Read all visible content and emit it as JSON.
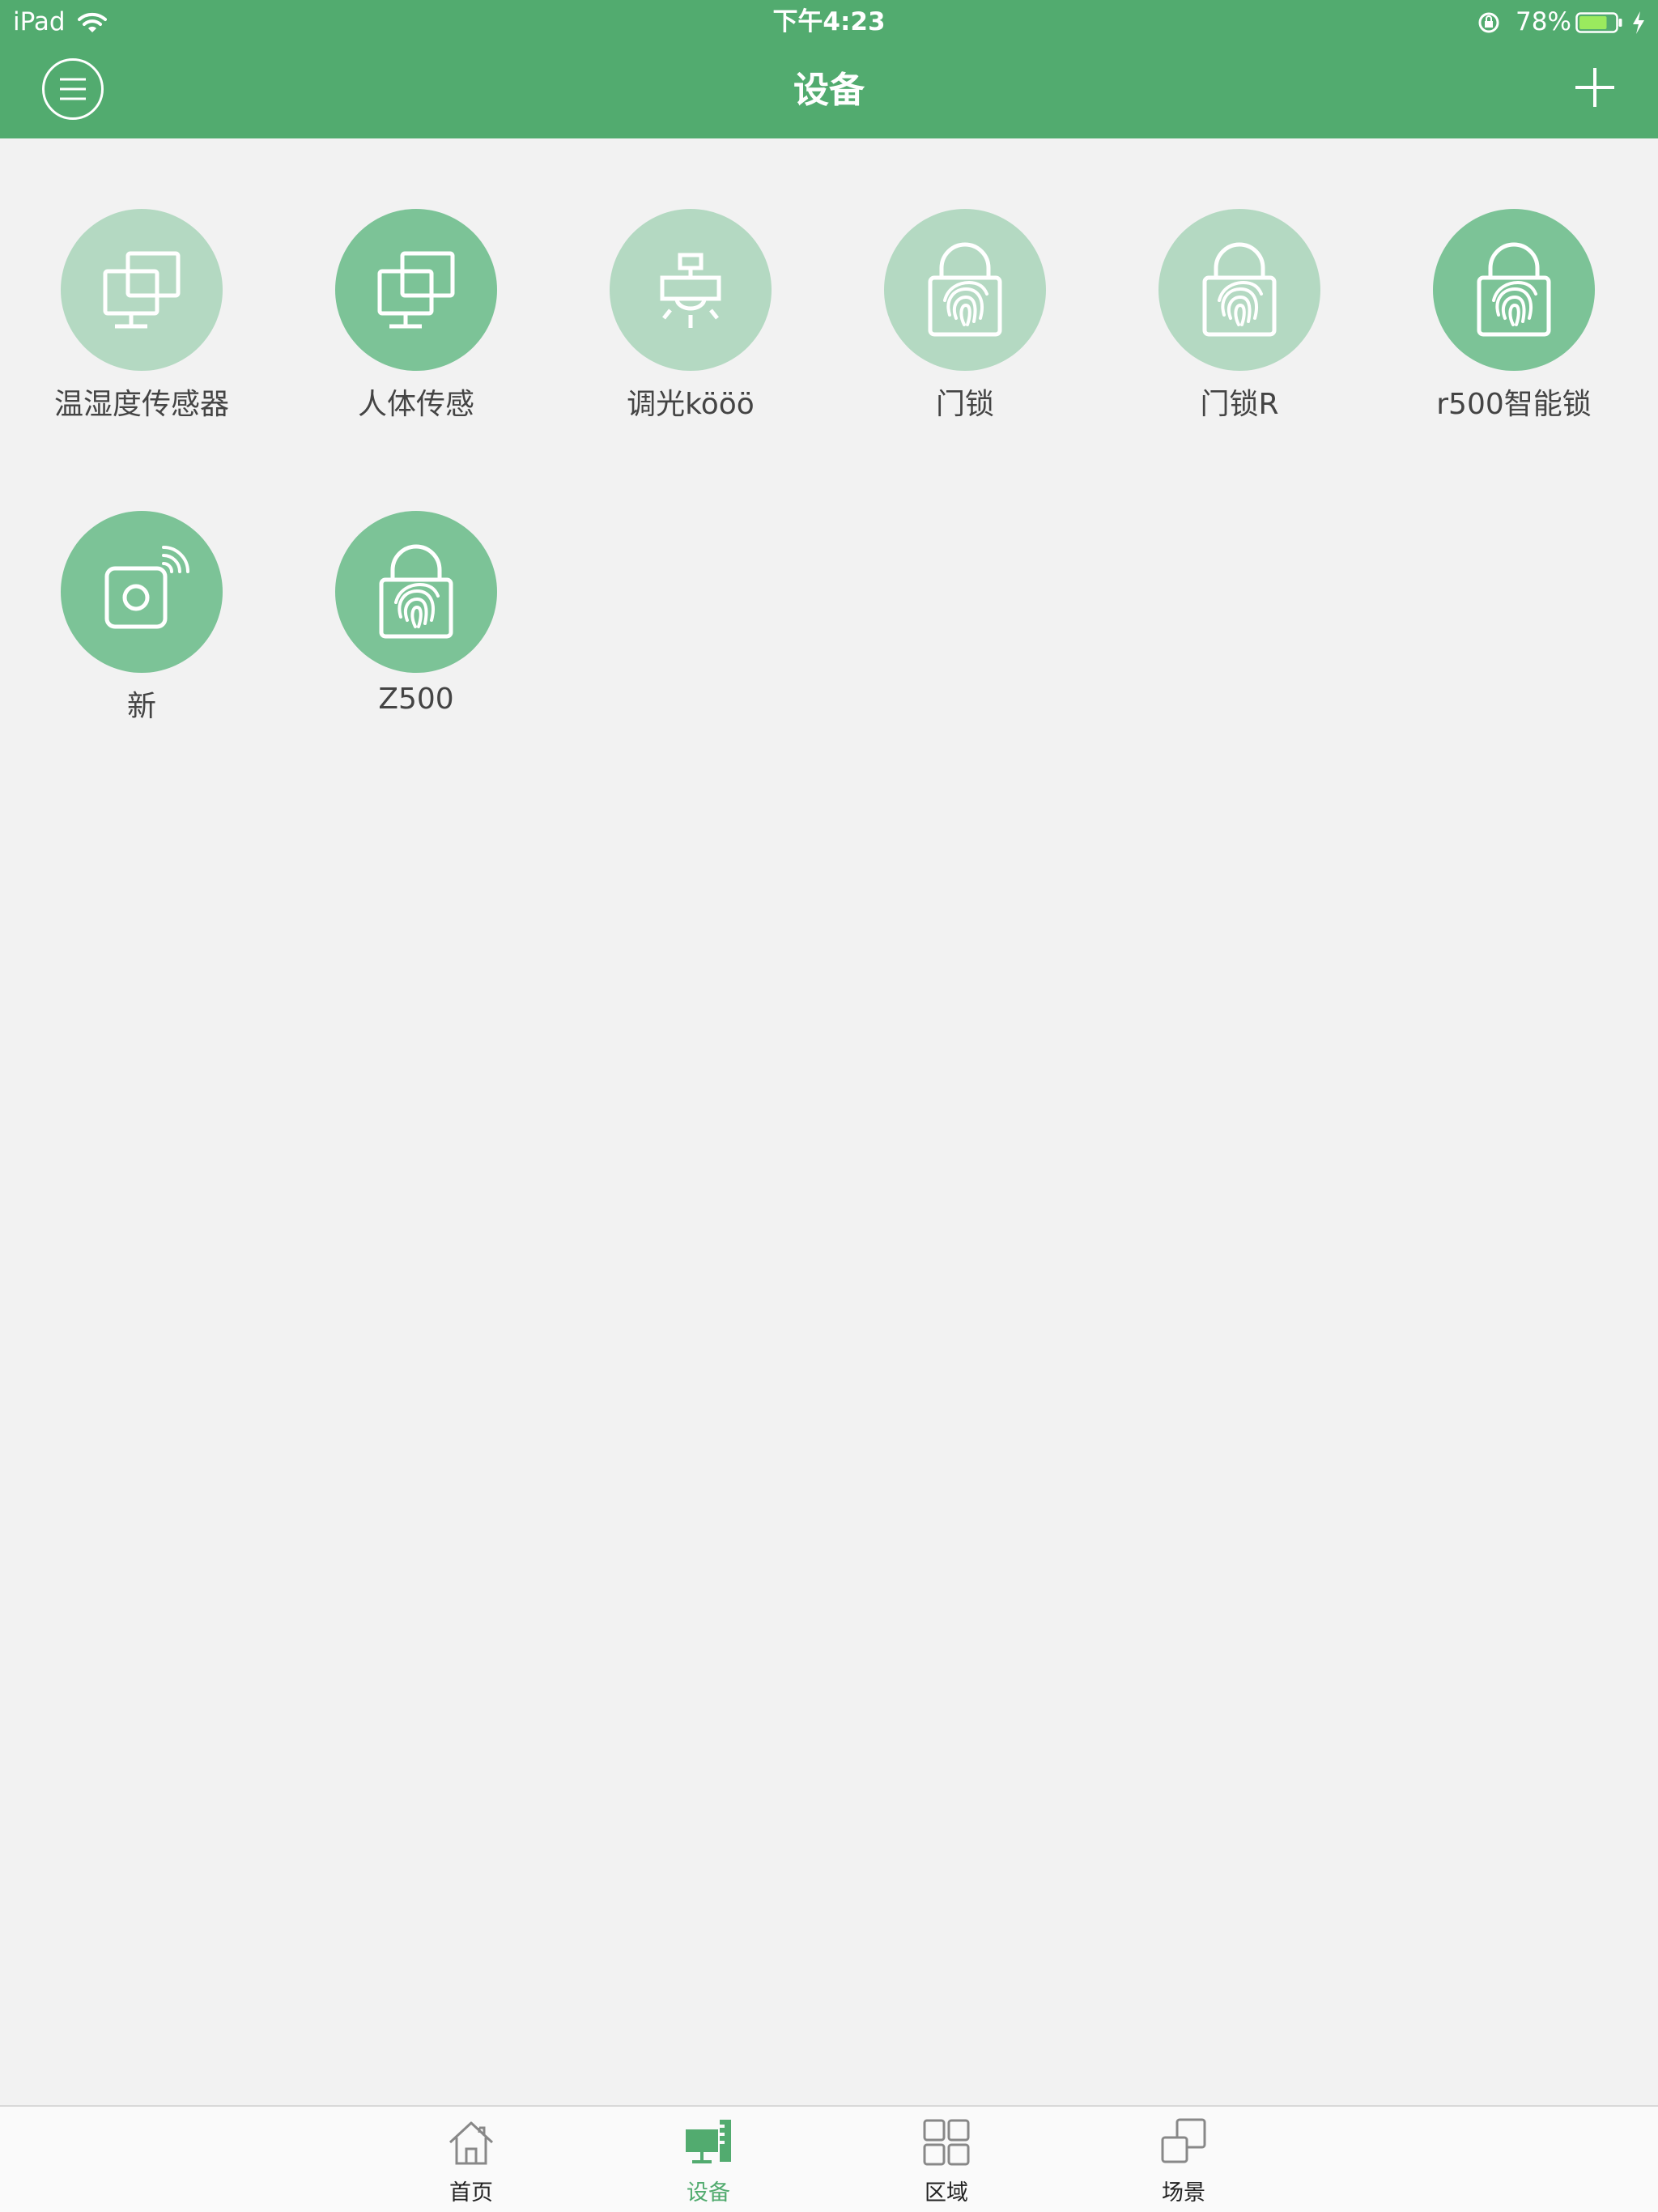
{
  "status_bar": {
    "device": "iPad",
    "time": "下午4:23",
    "battery": "78%",
    "battery_level": 0.78
  },
  "header": {
    "title": "设备",
    "menu_icon": "menu-icon",
    "add_icon": "plus-icon"
  },
  "colors": {
    "primary": "#52ab6f",
    "device_active": "#7cc397",
    "device_inactive": "#b4d9c2",
    "background": "#f2f2f2"
  },
  "devices": [
    {
      "label": "温湿度传感器",
      "icon": "monitor-icon",
      "active": false
    },
    {
      "label": "人体传感",
      "icon": "monitor-icon",
      "active": true
    },
    {
      "label": "调光kööö",
      "icon": "ceiling-light-icon",
      "active": false
    },
    {
      "label": "门锁",
      "icon": "fingerprint-lock-icon",
      "active": false
    },
    {
      "label": "门锁R",
      "icon": "fingerprint-lock-icon",
      "active": false
    },
    {
      "label": "r500智能锁",
      "icon": "fingerprint-lock-icon",
      "active": true
    },
    {
      "label": "新",
      "icon": "wireless-camera-icon",
      "active": true
    },
    {
      "label": "Z500",
      "icon": "fingerprint-lock-icon",
      "active": true
    }
  ],
  "tabs": [
    {
      "label": "首页",
      "icon": "home-icon",
      "active": false
    },
    {
      "label": "设备",
      "icon": "device-icon",
      "active": true
    },
    {
      "label": "区域",
      "icon": "grid-icon",
      "active": false
    },
    {
      "label": "场景",
      "icon": "scene-icon",
      "active": false
    }
  ]
}
